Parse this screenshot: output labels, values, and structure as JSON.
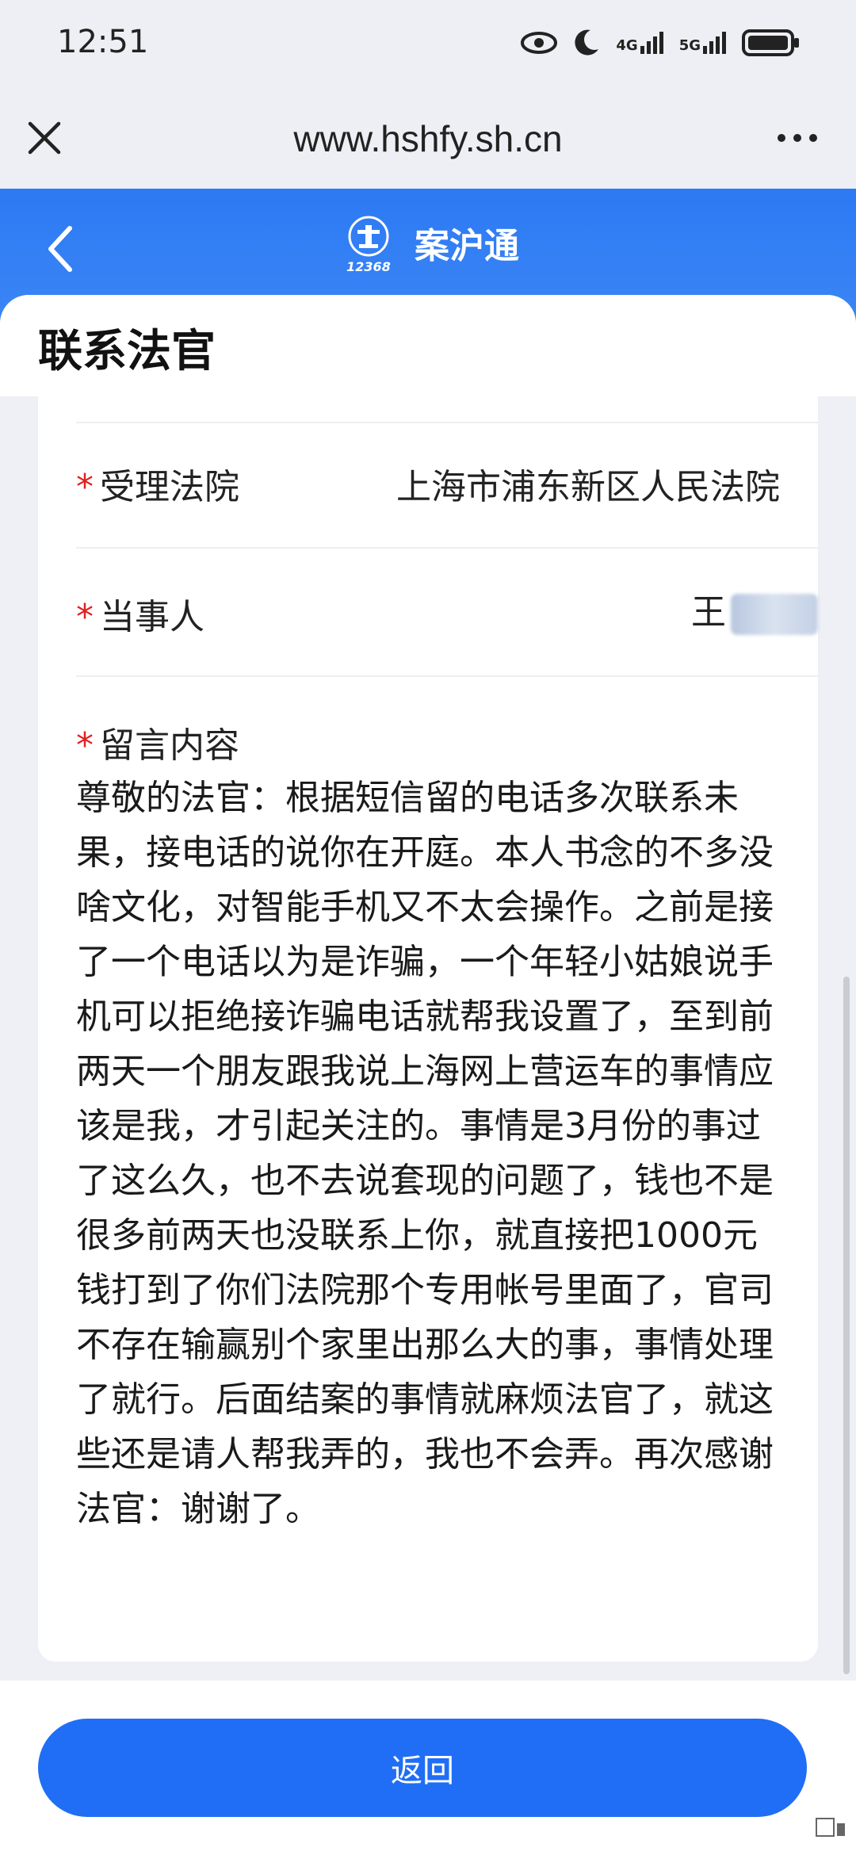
{
  "status_bar": {
    "time": "12:51",
    "icons": [
      "eye-icon",
      "moon-icon",
      "signal-4g-icon",
      "signal-5g-icon",
      "battery-icon"
    ],
    "net1": "4G",
    "net2": "5G"
  },
  "browser": {
    "url": "www.hshfy.sh.cn",
    "close_icon": "close-icon",
    "more_icon": "more-icon"
  },
  "app_header": {
    "title": "案沪通",
    "logo_text": "12368",
    "back_icon": "chevron-left-icon",
    "color": "#3a86f5"
  },
  "page": {
    "title": "联系法官"
  },
  "form": {
    "required_mark": "*",
    "court_label": "受理法院",
    "court_value": "上海市浦东新区人民法院",
    "party_label": "当事人",
    "party_value": "王",
    "message_label": "留言内容",
    "message_text": "尊敬的法官：根据短信留的电话多次联系未果，接电话的说你在开庭。本人书念的不多没啥文化，对智能手机又不太会操作。之前是接了一个电话以为是诈骗，一个年轻小姑娘说手机可以拒绝接诈骗电话就帮我设置了，至到前两天一个朋友跟我说上海网上营运车的事情应该是我，才引起关注的。事情是3月份的事过了这么久，也不去说套现的问题了，钱也不是很多前两天也没联系上你，就直接把1000元钱打到了你们法院那个专用帐号里面了，官司不存在输赢别个家里出那么大的事，事情处理了就行。后面结案的事情就麻烦法官了，就这些还是请人帮我弄的，我也不会弄。再次感谢法官：谢谢了。"
  },
  "footer": {
    "return_label": "返回",
    "button_color": "#1f6ef5"
  }
}
